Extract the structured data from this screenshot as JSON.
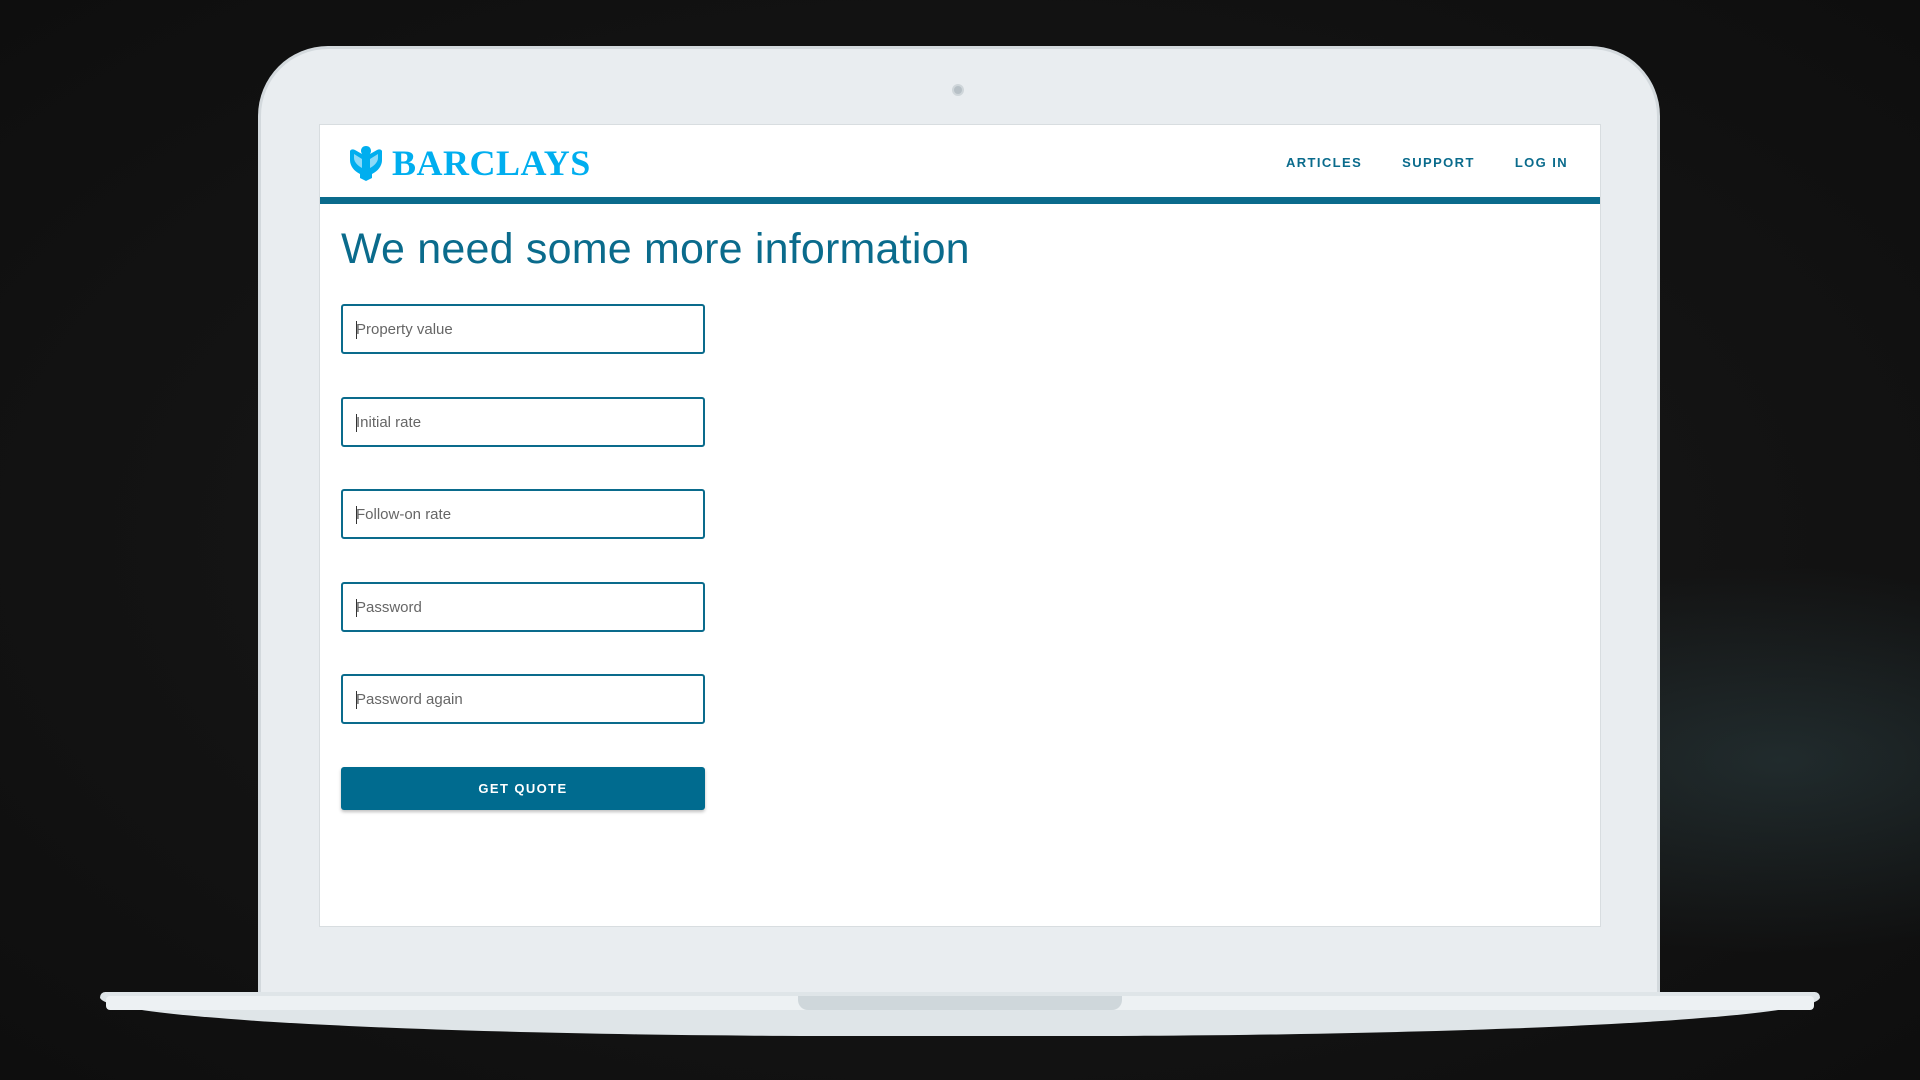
{
  "brand": {
    "name": "BARCLAYS",
    "logo_icon": "eagle-icon",
    "color": "#00aeef"
  },
  "nav": {
    "items": [
      {
        "label": "ARTICLES"
      },
      {
        "label": "SUPPORT"
      },
      {
        "label": "LOG IN"
      }
    ]
  },
  "page": {
    "title": "We need some more information"
  },
  "form": {
    "fields": [
      {
        "placeholder": "Property value",
        "value": ""
      },
      {
        "placeholder": "Initial rate",
        "value": ""
      },
      {
        "placeholder": "Follow-on rate",
        "value": ""
      },
      {
        "placeholder": "Password",
        "value": ""
      },
      {
        "placeholder": "Password again",
        "value": ""
      }
    ],
    "submit_label": "GET QUOTE"
  },
  "colors": {
    "accent": "#0a6b8c",
    "button": "#006b8f"
  }
}
